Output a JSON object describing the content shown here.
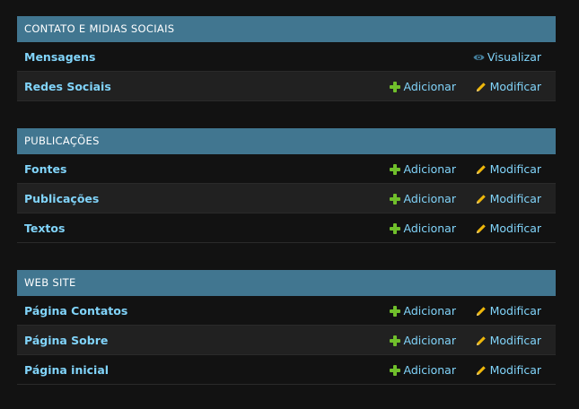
{
  "modules": [
    {
      "title": "CONTATO E MIDIAS SOCIAIS",
      "rows": [
        {
          "name": "Mensagens",
          "view": "Visualizar"
        },
        {
          "name": "Redes Sociais",
          "add": "Adicionar",
          "change": "Modificar"
        }
      ]
    },
    {
      "title": "PUBLICAÇÕES",
      "rows": [
        {
          "name": "Fontes",
          "add": "Adicionar",
          "change": "Modificar"
        },
        {
          "name": "Publicações",
          "add": "Adicionar",
          "change": "Modificar"
        },
        {
          "name": "Textos",
          "add": "Adicionar",
          "change": "Modificar"
        }
      ]
    },
    {
      "title": "WEB SITE",
      "rows": [
        {
          "name": "Página Contatos",
          "add": "Adicionar",
          "change": "Modificar"
        },
        {
          "name": "Página Sobre",
          "add": "Adicionar",
          "change": "Modificar"
        },
        {
          "name": "Página inicial",
          "add": "Adicionar",
          "change": "Modificar"
        }
      ]
    }
  ],
  "colors": {
    "header_bg": "#417690",
    "link": "#81d4fa",
    "add_icon": "#70bf2b",
    "change_icon": "#efb80b",
    "view_icon": "#447e9b"
  }
}
